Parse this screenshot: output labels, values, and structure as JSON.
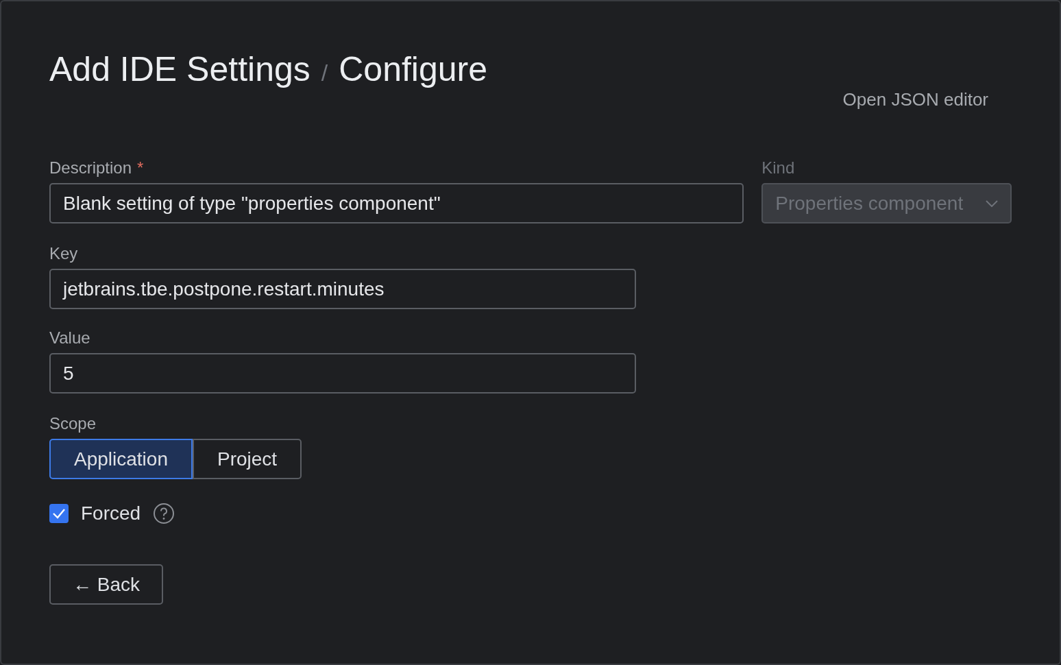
{
  "header": {
    "title": "Add IDE Settings",
    "separator": "/",
    "subtitle": "Configure",
    "json_editor_link": "Open JSON editor"
  },
  "fields": [
    {
      "kind": "text",
      "label": "Description",
      "required_mark": "*",
      "value": "Blank setting of type \"properties component\"",
      "disabled": false
    },
    {
      "kind": "select",
      "label": "Kind",
      "value": "Properties component",
      "disabled": true
    },
    {
      "kind": "text",
      "label": "Key",
      "value": "jetbrains.tbe.postpone.restart.minutes",
      "disabled": false
    },
    {
      "kind": "text",
      "label": "Value",
      "value": "5",
      "disabled": false
    }
  ],
  "scope": {
    "label": "Scope",
    "options": [
      {
        "label": "Application",
        "selected": true
      },
      {
        "label": "Project",
        "selected": false
      }
    ]
  },
  "forced": {
    "label": "Forced",
    "checked": true
  },
  "back_button": {
    "label": "← Back"
  }
}
